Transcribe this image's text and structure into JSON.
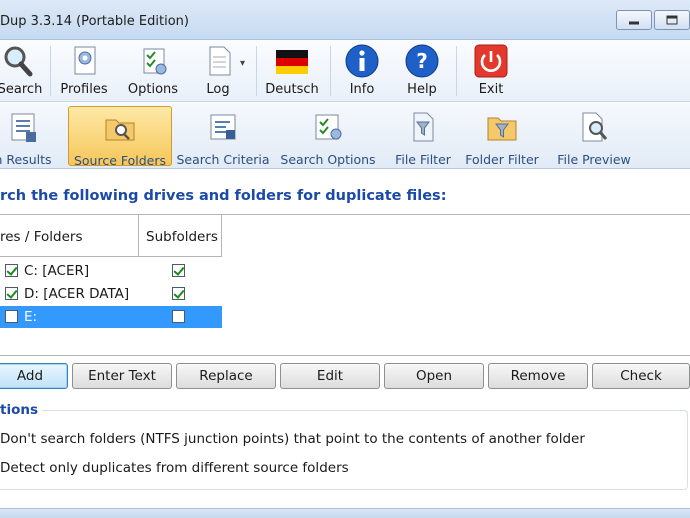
{
  "window": {
    "title": "Dup 3.3.14 (Portable Edition)"
  },
  "toolbar": [
    {
      "label": "Search",
      "icon": "magnifier-icon"
    },
    {
      "label": "Profiles",
      "icon": "profiles-icon"
    },
    {
      "label": "Options",
      "icon": "options-icon"
    },
    {
      "label": "Log",
      "icon": "log-icon"
    },
    {
      "label": "Deutsch",
      "icon": "german-flag-icon"
    },
    {
      "label": "Info",
      "icon": "info-icon"
    },
    {
      "label": "Help",
      "icon": "help-icon"
    },
    {
      "label": "Exit",
      "icon": "exit-icon"
    }
  ],
  "tabs": [
    {
      "label": "h Results",
      "icon": "results-icon"
    },
    {
      "label": "Source Folders",
      "icon": "source-folders-icon",
      "active": true
    },
    {
      "label": "Search Criteria",
      "icon": "search-criteria-icon"
    },
    {
      "label": "Search Options",
      "icon": "search-options-icon"
    },
    {
      "label": "File Filter",
      "icon": "file-filter-icon"
    },
    {
      "label": "Folder Filter",
      "icon": "folder-filter-icon"
    },
    {
      "label": "File Preview",
      "icon": "file-preview-icon"
    }
  ],
  "heading": "rch the following drives and folders for duplicate files:",
  "list": {
    "columns": [
      "res / Folders",
      "Subfolders"
    ],
    "rows": [
      {
        "name": "C: [ACER]",
        "checked": true,
        "subfolders": true
      },
      {
        "name": "D: [ACER DATA]",
        "checked": true,
        "subfolders": true
      },
      {
        "name": "E:",
        "checked": false,
        "subfolders": false,
        "selected": true
      }
    ]
  },
  "buttons": [
    "Add",
    "Enter Text",
    "Replace",
    "Edit",
    "Open",
    "Remove",
    "Check"
  ],
  "options": {
    "title": "tions",
    "items": [
      "Don't search folders (NTFS junction points) that point to the contents of another folder",
      "Detect only duplicates from different source folders"
    ]
  },
  "colors": {
    "accent": "#1c4aa8",
    "selection": "#3399ff",
    "active_tab": "#f7c65a"
  }
}
